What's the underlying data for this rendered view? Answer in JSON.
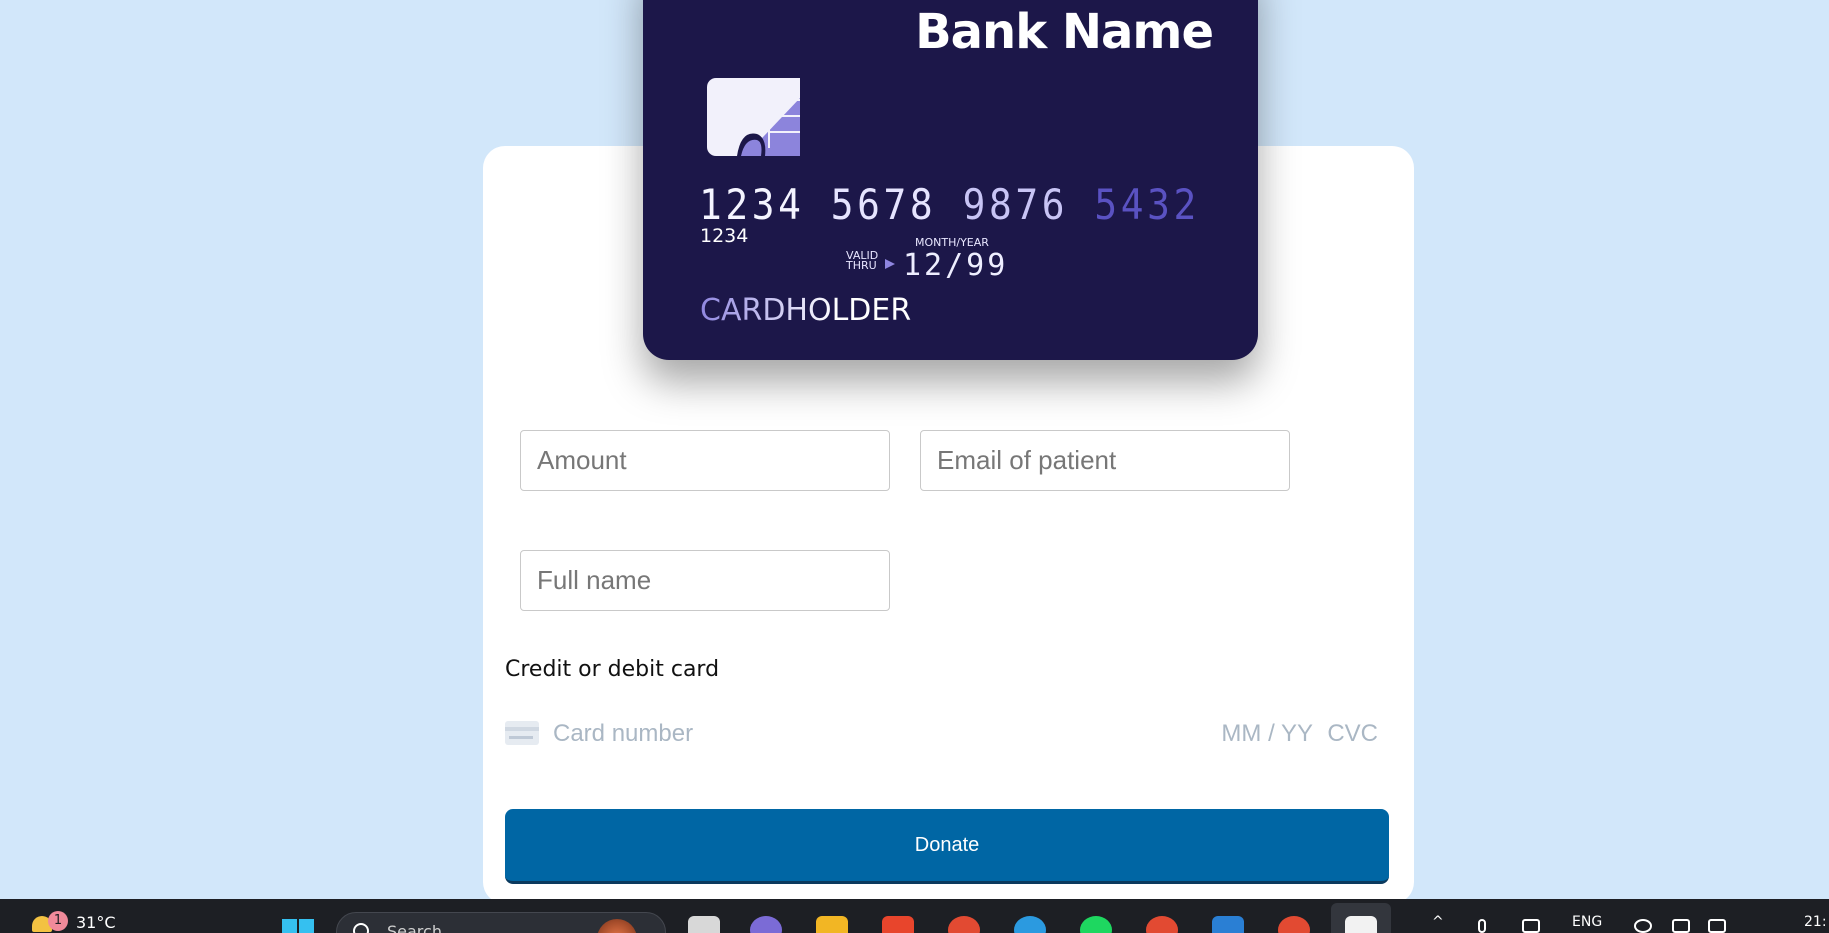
{
  "form": {
    "amount_placeholder": "Amount",
    "email_placeholder": "Email of patient",
    "fullname_placeholder": "Full name",
    "card_section_label": "Credit or debit card",
    "card_number_placeholder": "Card number",
    "expiry_placeholder": "MM / YY",
    "cvc_placeholder": "CVC",
    "donate_label": "Donate"
  },
  "card": {
    "bank_name": "Bank Name",
    "number_groups": [
      "1234",
      "5678",
      "9876",
      "5432"
    ],
    "small_number": "1234",
    "valid_thru": "VALID THRU",
    "month_year_label": "MONTH/YEAR",
    "expiry": "12/99",
    "holder": "CARDHOLDER"
  },
  "taskbar": {
    "weather_badge": "1",
    "temperature": "31°C",
    "search_text": "Search",
    "language": "ENG",
    "clock": "21:"
  },
  "colors": {
    "page_background": "#d2e7fa",
    "card_background": "#1c1749",
    "card_accent": "#8f86e0",
    "donate_button": "#0066a4",
    "taskbar": "#1d1f24"
  }
}
